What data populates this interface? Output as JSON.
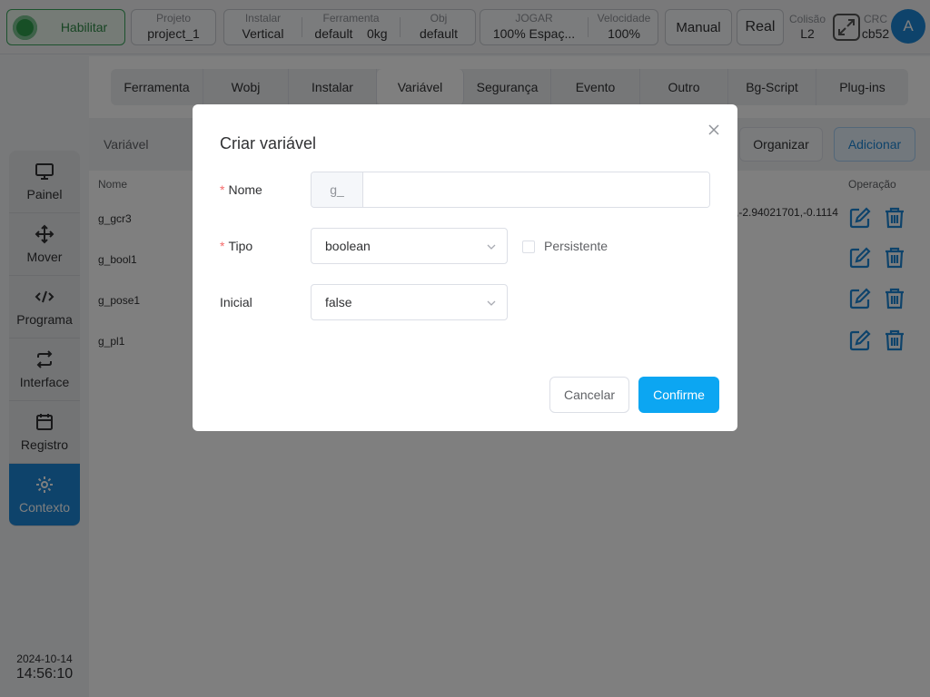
{
  "topbar": {
    "enable_label": "Habilitar",
    "project": {
      "label": "Projeto",
      "value": "project_1"
    },
    "install": {
      "label": "Instalar",
      "value": "Vertical"
    },
    "tool": {
      "label": "Ferramenta",
      "value_name": "default",
      "value_mass": "0kg"
    },
    "obj": {
      "label": "Obj",
      "value": "default"
    },
    "jog": {
      "label": "JOGAR",
      "value": "100%  Espaç..."
    },
    "speed": {
      "label": "Velocidade",
      "value": "100%"
    },
    "mode_label": "Manual",
    "real_label": "Real",
    "collision": {
      "label": "Colisão",
      "value": "L2"
    },
    "crc": {
      "label": "CRC",
      "value": "cb52"
    },
    "avatar_letter": "A",
    "icons": {
      "enable": "status-dot-icon",
      "crc": "expand-icon"
    }
  },
  "sidebar": {
    "items": [
      {
        "label": "Painel",
        "icon": "monitor-icon"
      },
      {
        "label": "Mover",
        "icon": "move-arrows-icon"
      },
      {
        "label": "Programa",
        "icon": "code-icon"
      },
      {
        "label": "Interface",
        "icon": "swap-icon"
      },
      {
        "label": "Registro",
        "icon": "calendar-icon"
      },
      {
        "label": "Contexto",
        "icon": "gear-icon"
      }
    ],
    "date": "2024-10-14",
    "time": "14:56:10"
  },
  "main": {
    "tabs": [
      {
        "label": "Ferramenta"
      },
      {
        "label": "Wobj"
      },
      {
        "label": "Instalar"
      },
      {
        "label": "Variável"
      },
      {
        "label": "Segurança"
      },
      {
        "label": "Evento"
      },
      {
        "label": "Outro"
      },
      {
        "label": "Bg-Script"
      },
      {
        "label": "Plug-ins"
      }
    ],
    "active_tab": "Variável",
    "section_title": "Variável",
    "organize_label": "Organizar",
    "add_label": "Adicionar",
    "columns": {
      "name": "Nome",
      "operation": "Operação"
    },
    "rows": [
      {
        "name": "g_gcr3",
        "value": ",-2.94021701,-0.1114"
      },
      {
        "name": "g_bool1",
        "value": ""
      },
      {
        "name": "g_pose1",
        "value": ""
      },
      {
        "name": "g_pl1",
        "value": ""
      }
    ],
    "colors": {
      "accent": "#1c87d6",
      "confirm": "#0ca6f2",
      "required": "#f56c6c"
    }
  },
  "modal": {
    "title": "Criar variável",
    "name_label": "Nome",
    "name_prefix": "g_",
    "name_value": "",
    "type_label": "Tipo",
    "type_value": "boolean",
    "persistent_label": "Persistente",
    "persistent_checked": false,
    "initial_label": "Inicial",
    "initial_value": "false",
    "cancel_label": "Cancelar",
    "confirm_label": "Confirme",
    "required_mark": "*"
  }
}
